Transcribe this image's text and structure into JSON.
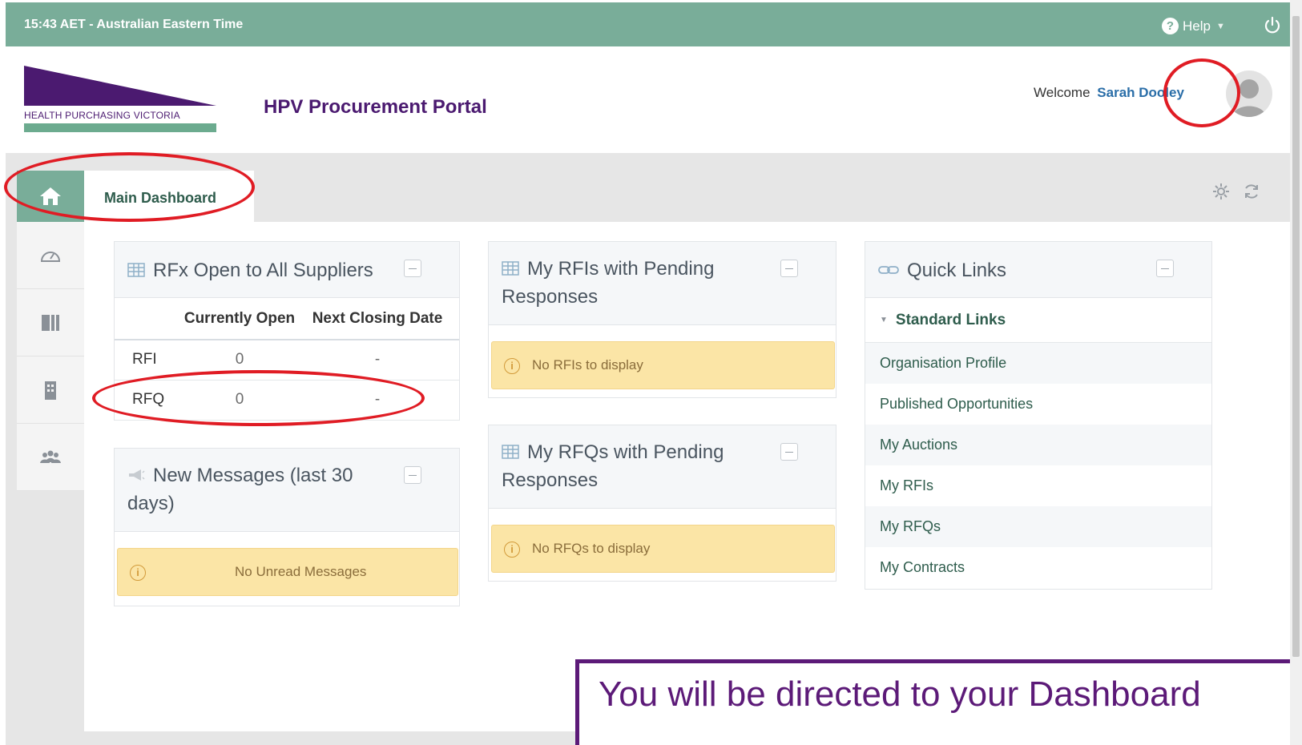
{
  "topbar": {
    "time": "15:43 AET - Australian Eastern Time",
    "help_label": "Help"
  },
  "header": {
    "logo_text": "HEALTH PURCHASING VICTORIA",
    "portal_title": "HPV Procurement Portal",
    "welcome_prefix": "Welcome",
    "user_name": "Sarah Dooley"
  },
  "tabs": {
    "main": "Main Dashboard"
  },
  "rfx_panel": {
    "title": "RFx Open to All Suppliers",
    "columns": [
      "Currently Open",
      "Next Closing Date"
    ],
    "rows": [
      {
        "type": "RFI",
        "open": "0",
        "date": "-"
      },
      {
        "type": "RFQ",
        "open": "0",
        "date": "-"
      }
    ]
  },
  "messages_panel": {
    "title_line1": "New Messages (last 30",
    "title_line2": "days)",
    "alert": "No Unread Messages"
  },
  "rfis_panel": {
    "title_line1": "My RFIs with Pending",
    "title_line2": "Responses",
    "alert": "No RFIs to display"
  },
  "rfqs_panel": {
    "title_line1": "My RFQs with Pending",
    "title_line2": "Responses",
    "alert": "No RFQs to display"
  },
  "quick_links": {
    "title": "Quick Links",
    "group": "Standard Links",
    "items": [
      "Organisation Profile",
      "Published Opportunities",
      "My Auctions",
      "My RFIs",
      "My RFQs",
      "My Contracts"
    ]
  },
  "caption": "You will be directed to your Dashboard",
  "colors": {
    "topbar": "#79ad99",
    "brand_purple": "#4b1a70",
    "annotation_red": "#e01c24",
    "alert_bg": "#fbe5a6"
  }
}
